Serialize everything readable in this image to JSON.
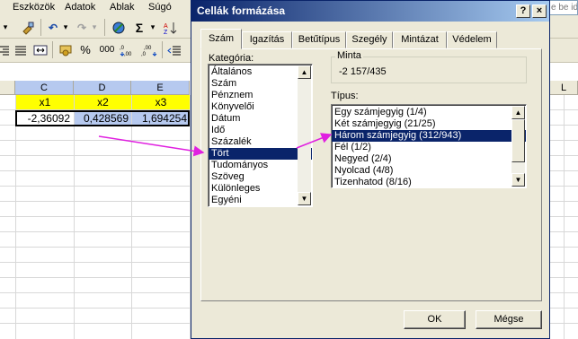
{
  "menu": [
    "Eszközök",
    "Adatok",
    "Ablak",
    "Súgó"
  ],
  "help_box_text": "e be ide",
  "toolbar": {
    "percent": "%",
    "thousands": "000",
    "sigma": "Σ"
  },
  "sheet": {
    "column_headers": [
      "C",
      "D",
      "E",
      "L"
    ],
    "header_row": [
      "x1",
      "x2",
      "x3"
    ],
    "values": [
      "-2,36092",
      "0,428569",
      "1,694254"
    ]
  },
  "dialog": {
    "title": "Cellák formázása",
    "help_button": "?",
    "close_button": "×",
    "tabs": [
      "Szám",
      "Igazítás",
      "Betűtípus",
      "Szegély",
      "Mintázat",
      "Védelem"
    ],
    "active_tab": "Szám",
    "category_label": "Kategória:",
    "categories": [
      "Általános",
      "Szám",
      "Pénznem",
      "Könyvelői",
      "Dátum",
      "Idő",
      "Százalék",
      "Tört",
      "Tudományos",
      "Szöveg",
      "Különleges",
      "Egyéni"
    ],
    "selected_category": "Tört",
    "sample_label": "Minta",
    "sample_value": "-2 157/435",
    "type_label": "Típus:",
    "types": [
      "Egy számjegyig (1/4)",
      "Két számjegyig (21/25)",
      "Három számjegyig (312/943)",
      "Fél (1/2)",
      "Negyed (2/4)",
      "Nyolcad (4/8)",
      "Tizenhatod (8/16)"
    ],
    "selected_type": "Három számjegyig (312/943)",
    "ok_label": "OK",
    "cancel_label": "Mégse"
  },
  "colors": {
    "title_start": "#0a246a",
    "title_end": "#a6caf0",
    "selection": "#0a246a",
    "annotation_arrow": "#e020e0",
    "highlight_yellow": "#ffff00"
  }
}
